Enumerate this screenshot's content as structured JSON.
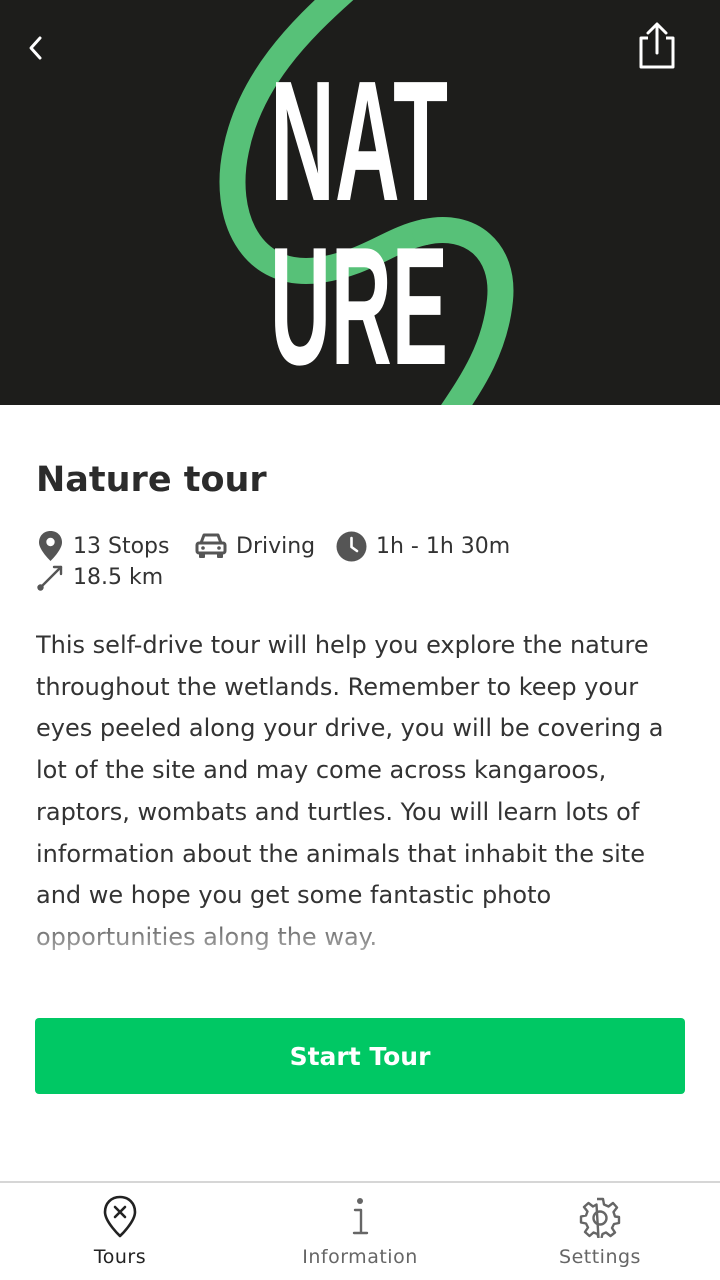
{
  "colors": {
    "hero_background": "#1d1d1b",
    "hero_ribbon": "#57c178",
    "accent_green": "#00c864",
    "text_dark": "#2b2b2b",
    "tab_inactive": "#666666"
  },
  "hero": {
    "logo_line1": "NAT",
    "logo_line2": "URE",
    "back_icon": "chevron-left-icon",
    "share_icon": "share-icon"
  },
  "tour": {
    "title": "Nature tour",
    "stops": "13 Stops",
    "mode": "Driving",
    "duration": "1h - 1h 30m",
    "distance": "18.5 km",
    "description": "This self-drive tour will help you explore the nature throughout the wetlands. Remember to keep your eyes peeled along your drive, you will be covering a lot of the site and may come across kangaroos, raptors, wombats and turtles. You will learn lots of information about the animals that inhabit the site and we hope you get some fantastic photo opportunities along the way."
  },
  "actions": {
    "start_label": "Start Tour"
  },
  "tabs": [
    {
      "label": "Tours",
      "icon": "map-pin-x-icon",
      "active": true
    },
    {
      "label": "Information",
      "icon": "info-icon",
      "active": false
    },
    {
      "label": "Settings",
      "icon": "gear-icon",
      "active": false
    }
  ]
}
